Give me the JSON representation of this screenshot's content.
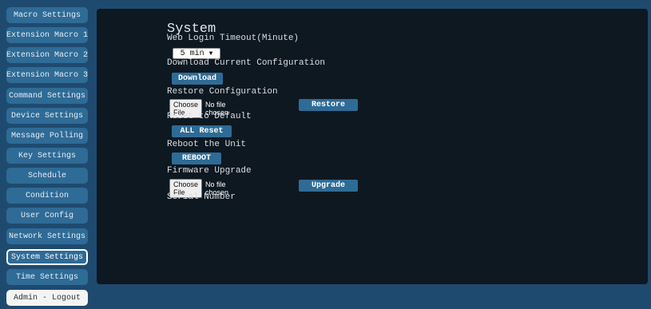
{
  "sidebar": {
    "items": [
      {
        "label": "Macro Settings",
        "active": false
      },
      {
        "label": "Extension Macro 1",
        "active": false
      },
      {
        "label": "Extension Macro 2",
        "active": false
      },
      {
        "label": "Extension Macro 3",
        "active": false
      },
      {
        "label": "Command Settings",
        "active": false
      },
      {
        "label": "Device Settings",
        "active": false
      },
      {
        "label": "Message Polling",
        "active": false
      },
      {
        "label": "Key Settings",
        "active": false
      },
      {
        "label": "Schedule",
        "active": false
      },
      {
        "label": "Condition",
        "active": false
      },
      {
        "label": "User Config",
        "active": false
      },
      {
        "label": "Network Settings",
        "active": false
      },
      {
        "label": "System Settings",
        "active": true
      },
      {
        "label": "Time Settings",
        "active": false
      }
    ],
    "logout_label": "Admin - Logout"
  },
  "system": {
    "title": "System",
    "login_timeout_label": "Web Login Timeout(Minute)",
    "login_timeout_value": "5 min",
    "download_label": "Download Current Configuration",
    "download_button": "Download",
    "restore_label": "Restore Configuration",
    "restore_choose": "Choose File",
    "restore_file_status": "No file chosen",
    "restore_button": "Restore",
    "reset_label": "Reset to Default",
    "reset_button": "ALL Reset",
    "reboot_label": "Reboot the Unit",
    "reboot_button": "REBOOT",
    "firmware_label": "Firmware Upgrade",
    "firmware_choose": "Choose File",
    "firmware_file_status": "No file chosen",
    "upgrade_button": "Upgrade",
    "serial_label": "Serial Number"
  },
  "colors": {
    "background": "#1f4a6f",
    "panel": "#0e1821",
    "button": "#2e6b96"
  }
}
